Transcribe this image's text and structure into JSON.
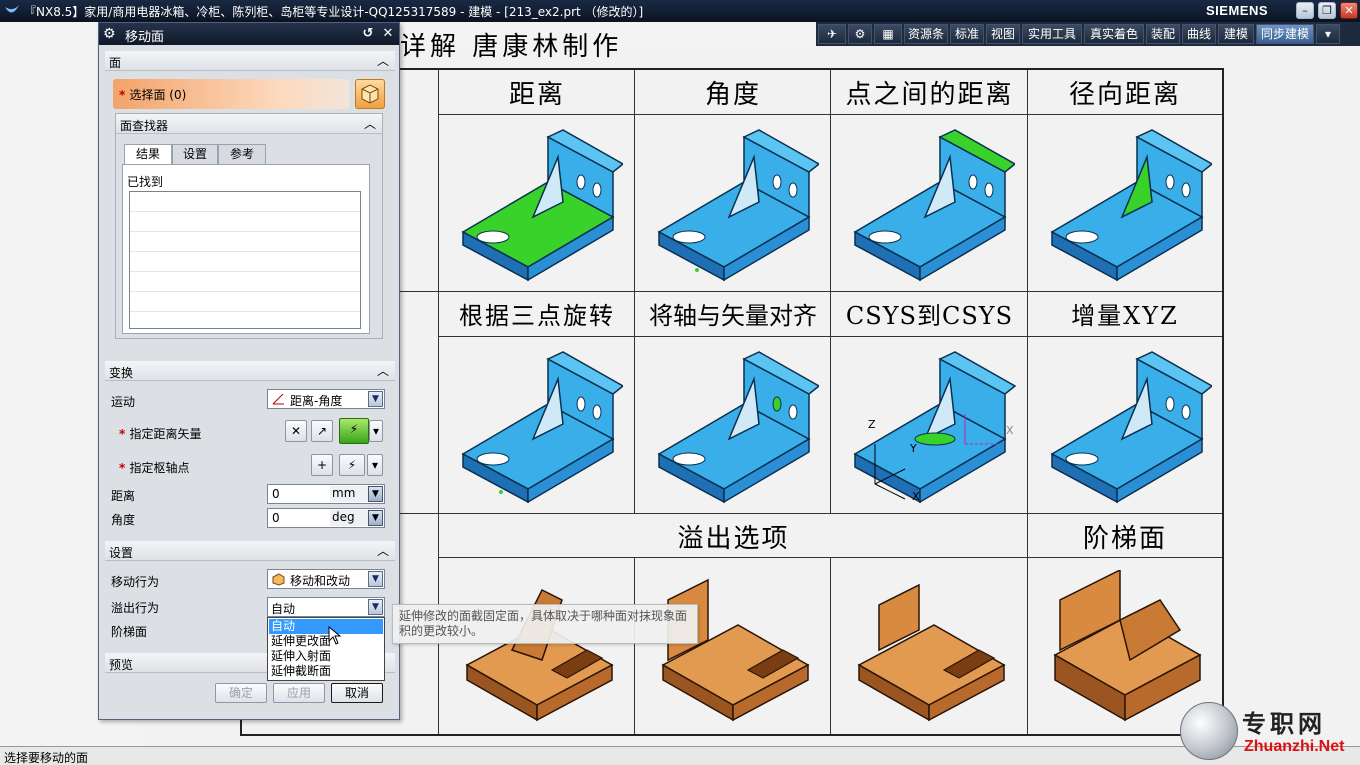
{
  "window": {
    "title": "『NX8.5】家用/商用电器冰箱、冷柜、陈列柜、岛柜等专业设计-QQ125317589 - 建模 - [213_ex2.prt （修改的）]",
    "brand": "SIEMENS"
  },
  "toolbar": {
    "items": [
      "资源条",
      "标准",
      "视图",
      "实用工具",
      "真实着色",
      "装配",
      "曲线",
      "建模",
      "同步建模"
    ]
  },
  "drawing": {
    "header": "详解  唐康林制作",
    "top_headers": [
      "距离",
      "角度",
      "点之间的距离",
      "径向距离"
    ],
    "mid_headers": [
      "根据三点旋转",
      "将轴与矢量对齐",
      "CSYS到CSYS",
      "增量XYZ"
    ],
    "bottom_headers": [
      "溢出选项",
      "阶梯面"
    ],
    "axis_labels": {
      "z": "Z",
      "y": "Y",
      "x": "X",
      "x2": "X"
    }
  },
  "dialog": {
    "title": "移动面",
    "section_face": "面",
    "select_face": "选择面 (0)",
    "face_finder": "面查找器",
    "tabs": [
      "结果",
      "设置",
      "参考"
    ],
    "found_label": "已找到",
    "section_transform": "变换",
    "motion_label": "运动",
    "motion_value": "距离-角度",
    "distance_vector_label": "指定距离矢量",
    "pivot_label": "指定枢轴点",
    "distance_label": "距离",
    "distance_value": "0",
    "distance_unit": "mm",
    "angle_label": "角度",
    "angle_value": "0",
    "angle_unit": "deg",
    "section_settings": "设置",
    "move_behavior_label": "移动行为",
    "move_behavior_value": "移动和改动",
    "overflow_label": "溢出行为",
    "overflow_value": "自动",
    "step_face_label": "阶梯面",
    "overflow_options": [
      "自动",
      "延伸更改面",
      "延伸入射面",
      "延伸截断面"
    ],
    "section_preview": "预览",
    "ok": "确定",
    "apply": "应用",
    "cancel": "取消"
  },
  "tooltip": "延伸修改的面截固定面，具体取决于哪种面对抹现象面积的更改较小。",
  "status": "选择要移动的面",
  "watermark": {
    "cn": "专职网",
    "en": "Zhuanzhi.Net"
  },
  "colors": {
    "part_blue": "#3aaee8",
    "part_green": "#39d22a",
    "part_orange": "#d8823a",
    "selection": "#3399ff"
  }
}
